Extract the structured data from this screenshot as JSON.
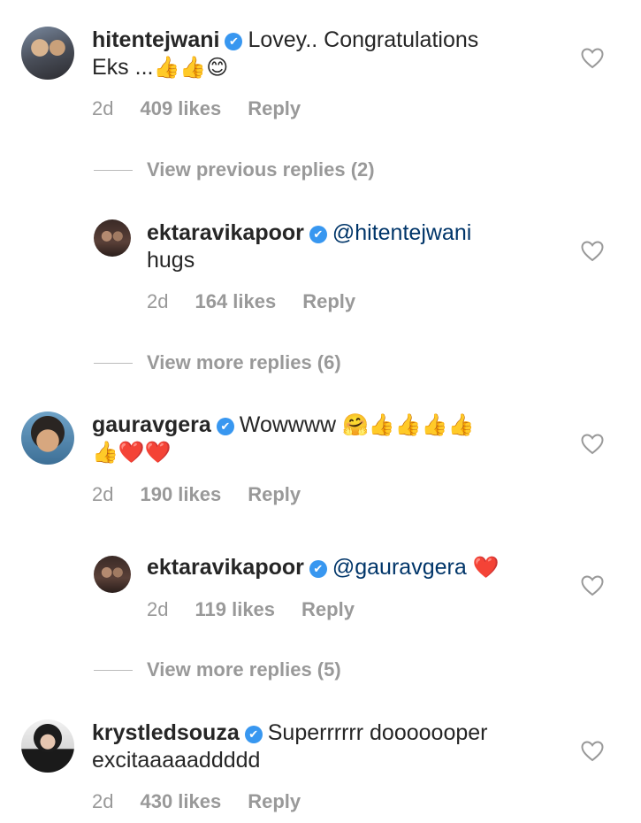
{
  "comments": [
    {
      "username": "hitentejwani",
      "verified_icon": "✔",
      "text_line1": "Lovey.. Congratulations",
      "text_line2": "Eks ...",
      "emojis_line2": "👍👍😊",
      "time": "2d",
      "likes": "409 likes",
      "reply": "Reply"
    },
    {
      "username": "ektaravikapoor",
      "verified_icon": "✔",
      "mention": "@hitentejwani",
      "text_line2": "hugs",
      "time": "2d",
      "likes": "164 likes",
      "reply": "Reply"
    },
    {
      "username": "gauravgera",
      "verified_icon": "✔",
      "text_line1": "Wowwww",
      "emojis_line1": "🤗👍👍👍👍",
      "emojis_line2": "👍❤️❤️",
      "time": "2d",
      "likes": "190 likes",
      "reply": "Reply"
    },
    {
      "username": "ektaravikapoor",
      "verified_icon": "✔",
      "mention": "@gauravgera",
      "emojis_line1": "❤️",
      "time": "2d",
      "likes": "119 likes",
      "reply": "Reply"
    },
    {
      "username": "krystledsouza",
      "verified_icon": "✔",
      "text_line1": "Superrrrrr dooooooper",
      "text_line2": "excitaaaaaddddd",
      "time": "2d",
      "likes": "430 likes",
      "reply": "Reply"
    }
  ],
  "view_previous": "View previous replies (2)",
  "view_more_1": "View more replies (6)",
  "view_more_2": "View more replies (5)",
  "icons": {
    "like": "heart-outline-icon",
    "verified": "verified-badge-icon"
  },
  "colors": {
    "verified": "#3897f0",
    "mention": "#003569",
    "meta": "#999999",
    "text": "#262626"
  }
}
